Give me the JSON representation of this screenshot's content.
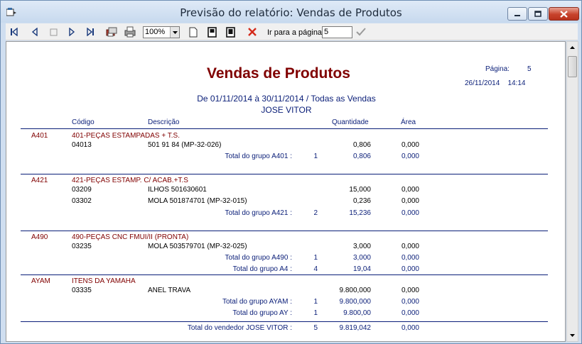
{
  "window": {
    "title": "Previsão do relatório: Vendas de Produtos",
    "min_icon": "minimize-icon",
    "max_icon": "maximize-icon",
    "close_icon": "close-icon"
  },
  "toolbar": {
    "zoom_value": "100%",
    "goto_label": "Ir para a página",
    "goto_value": "5"
  },
  "report": {
    "title": "Vendas de Produtos",
    "page_label": "Página:",
    "page_number": "5",
    "date": "26/11/2014",
    "time": "14:14",
    "period": "De 01/11/2014 à 30/11/2014 /  Todas as Vendas",
    "seller": "JOSE VITOR",
    "columns": {
      "code": "Código",
      "description": "Descrição",
      "quantity": "Quantidade",
      "area": "Área"
    },
    "rows": [
      {
        "kind": "group",
        "code": "A401",
        "name": "401-PEÇAS ESTAMPADAS +  T.S."
      },
      {
        "kind": "item",
        "code": "04013",
        "desc": "501 91 84  (MP-32-026)",
        "qty": "0,806",
        "area": "0,000"
      },
      {
        "kind": "total",
        "label": "Total do grupo A401 :",
        "count": "1",
        "qty": "0,806",
        "area": "0,000"
      },
      {
        "kind": "group",
        "code": "A421",
        "name": "421-PEÇAS ESTAMP. C/ ACAB.+T.S"
      },
      {
        "kind": "item",
        "code": "03209",
        "desc": "ILHOS 501630601",
        "qty": "15,000",
        "area": "0,000"
      },
      {
        "kind": "item",
        "code": "03302",
        "desc": "MOLA 501874701 (MP-32-015)",
        "qty": "0,236",
        "area": "0,000"
      },
      {
        "kind": "total",
        "label": "Total do grupo A421 :",
        "count": "2",
        "qty": "15,236",
        "area": "0,000"
      },
      {
        "kind": "group",
        "code": "A490",
        "name": "490-PEÇAS CNC FMUI/II (PRONTA)"
      },
      {
        "kind": "item",
        "code": "03235",
        "desc": "MOLA 503579701 (MP-32-025)",
        "qty": "3,000",
        "area": "0,000"
      },
      {
        "kind": "total",
        "label": "Total do grupo A490 :",
        "count": "1",
        "qty": "3,000",
        "area": "0,000"
      },
      {
        "kind": "total",
        "label": "Total do grupo A4 :",
        "count": "4",
        "qty": "19,04",
        "area": "0,000"
      },
      {
        "kind": "group",
        "code": "AYAM",
        "name": "ITENS DA YAMAHA"
      },
      {
        "kind": "item",
        "code": "03335",
        "desc": "ANEL TRAVA",
        "qty": "9.800,000",
        "area": "0,000"
      },
      {
        "kind": "total",
        "label": "Total do grupo AYAM :",
        "count": "1",
        "qty": "9.800,000",
        "area": "0,000"
      },
      {
        "kind": "total",
        "label": "Total do grupo AY :",
        "count": "1",
        "qty": "9.800,00",
        "area": "0,000"
      },
      {
        "kind": "total",
        "label": "Total do vendedor JOSE VITOR :",
        "count": "5",
        "qty": "9.819,042",
        "area": "0,000"
      }
    ]
  },
  "colors": {
    "title": "#800000",
    "text_blue": "#0a1e78",
    "close_red": "#c7422b"
  }
}
